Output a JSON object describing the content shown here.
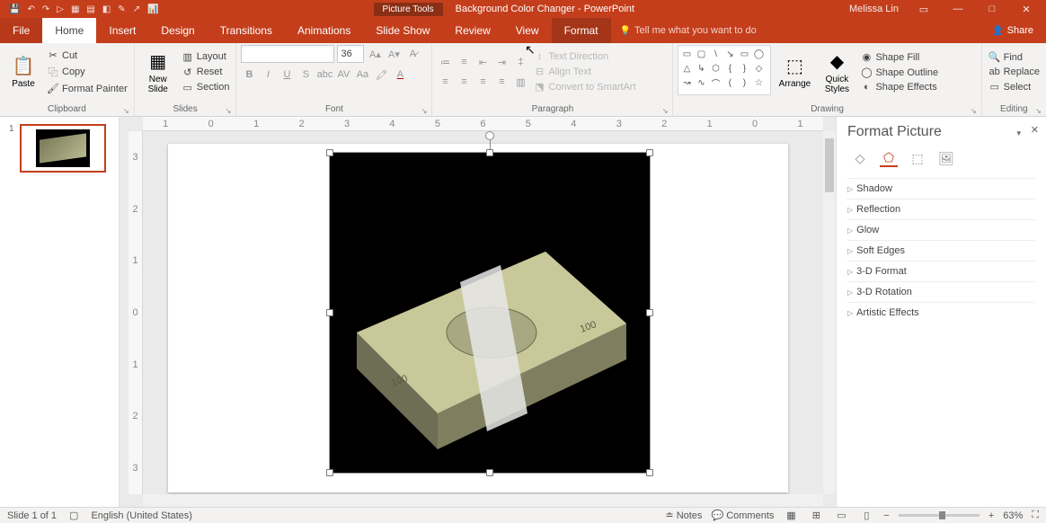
{
  "contextual_tab_title": "Picture Tools",
  "document_title": "Background Color Changer  -  PowerPoint",
  "user_name": "Melissa Lin",
  "tabs": {
    "file": "File",
    "home": "Home",
    "insert": "Insert",
    "design": "Design",
    "transitions": "Transitions",
    "animations": "Animations",
    "slideshow": "Slide Show",
    "review": "Review",
    "view": "View",
    "format": "Format"
  },
  "tellme_placeholder": "Tell me what you want to do",
  "share_label": "Share",
  "groups": {
    "clipboard": {
      "label": "Clipboard",
      "paste": "Paste",
      "cut": "Cut",
      "copy": "Copy",
      "format_painter": "Format Painter"
    },
    "slides": {
      "label": "Slides",
      "new_slide": "New Slide",
      "layout": "Layout",
      "reset": "Reset",
      "section": "Section"
    },
    "font": {
      "label": "Font",
      "size": "36"
    },
    "paragraph": {
      "label": "Paragraph",
      "text_direction": "Text Direction",
      "align_text": "Align Text",
      "smartart": "Convert to SmartArt"
    },
    "drawing": {
      "label": "Drawing",
      "arrange": "Arrange",
      "quick_styles": "Quick Styles",
      "shape_fill": "Shape Fill",
      "shape_outline": "Shape Outline",
      "shape_effects": "Shape Effects"
    },
    "editing": {
      "label": "Editing",
      "find": "Find",
      "replace": "Replace",
      "select": "Select"
    }
  },
  "thumbnail_number": "1",
  "format_pane": {
    "title": "Format Picture",
    "items": [
      "Shadow",
      "Reflection",
      "Glow",
      "Soft Edges",
      "3-D Format",
      "3-D Rotation",
      "Artistic Effects"
    ]
  },
  "ruler_h": [
    "1",
    "0",
    "1",
    "2",
    "3",
    "4",
    "5",
    "6",
    "5",
    "4",
    "3",
    "2",
    "1",
    "0",
    "1"
  ],
  "ruler_v": [
    "3",
    "2",
    "1",
    "0",
    "1",
    "2",
    "3"
  ],
  "status": {
    "slide": "Slide 1 of 1",
    "language": "English (United States)",
    "notes": "Notes",
    "comments": "Comments",
    "zoom": "63%"
  }
}
